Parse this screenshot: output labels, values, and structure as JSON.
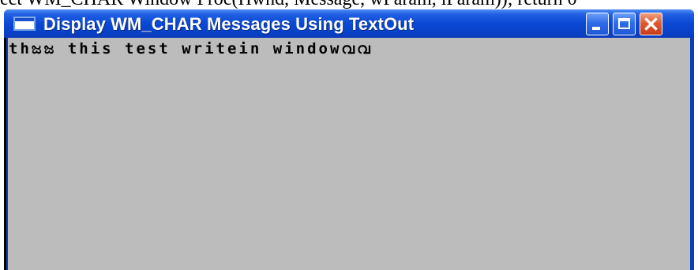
{
  "background_code": "ect WM_CHAR Window Proc(Hwnd, Message, wParam, lParam)); return 0",
  "window": {
    "title": "Display WM_CHAR Messages Using TextOut",
    "client_text": "thಜಜ this test writein windowവവ"
  },
  "colors": {
    "titlebar": "#0a48d4",
    "client_bg": "#bcbcbc",
    "close_button": "#e05a30"
  },
  "icons": [
    "app-icon",
    "minimize-icon",
    "maximize-icon",
    "close-icon"
  ]
}
